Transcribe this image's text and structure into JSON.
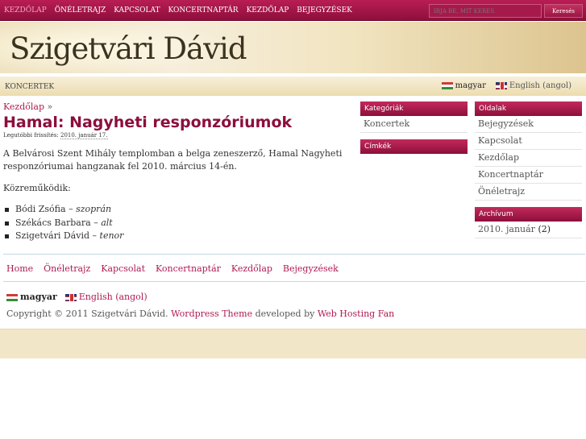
{
  "topnav": {
    "items": [
      "Kezdőlap",
      "Önéletrajz",
      "Kapcsolat",
      "Koncertnaptár",
      "Kezdőlap",
      "Bejegyzések"
    ],
    "current_index": 0
  },
  "search": {
    "placeholder": "Írja be, mit keres",
    "button": "Keresés"
  },
  "header": {
    "title": "Szigetvári Dávid"
  },
  "subbar": {
    "section": "Koncertek",
    "lang_hu": "magyar",
    "lang_en": "English (angol)"
  },
  "breadcrumb": {
    "home": "Kezdőlap",
    "separator": "»"
  },
  "post": {
    "title": "Hamal: Nagyheti responzóriumok",
    "updated_label": "Legutóbbi frissítés:",
    "updated_date": "2010. január 17.",
    "intro": "A Belvárosi Szent Mihály templomban a belga zeneszerző, Hamal Nagyheti responzóriumai hangzanak fel 2010. március 14-én.",
    "performers_heading": "Közreműködik:",
    "performers": [
      {
        "name": "Bódi Zsófia",
        "dash": "–",
        "role": "szoprán"
      },
      {
        "name": "Székács Barbara",
        "dash": "–",
        "role": "alt"
      },
      {
        "name": "Szigetvári Dávid",
        "dash": "–",
        "role": "tenor"
      }
    ]
  },
  "sidebar_left": {
    "categories_title": "Kategóriák",
    "categories": [
      "Koncertek"
    ],
    "tags_title": "Címkék"
  },
  "sidebar_right": {
    "pages_title": "Oldalak",
    "pages": [
      "Bejegyzések",
      "Kapcsolat",
      "Kezdőlap",
      "Koncertnaptár",
      "Önéletrajz"
    ],
    "archive_title": "Archívum",
    "archive_month": "2010. január",
    "archive_count": "(2)"
  },
  "footer": {
    "nav": [
      "Home",
      "Önéletrajz",
      "Kapcsolat",
      "Koncertnaptár",
      "Kezdőlap",
      "Bejegyzések"
    ],
    "lang_hu": "magyar",
    "lang_en": "English (angol)",
    "copyright_text": "Copyright © 2011 Szigetvári Dávid.",
    "theme_link": "Wordpress Theme",
    "developed_by": "developed by",
    "host_link": "Web Hosting Fan"
  },
  "colors": {
    "accent": "#8c0e3c",
    "link": "#b01a52",
    "header_bg": "#efe3c1"
  }
}
